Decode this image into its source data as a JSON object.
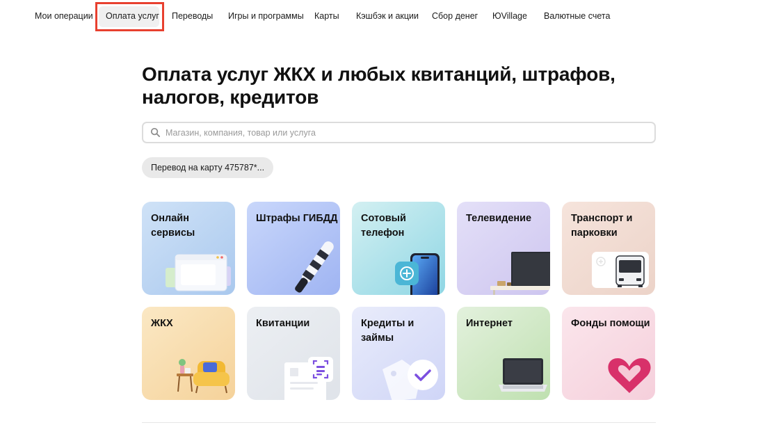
{
  "nav": {
    "items": [
      {
        "label": "Мои операции"
      },
      {
        "label": "Оплата услуг"
      },
      {
        "label": "Переводы"
      },
      {
        "label": "Игры и программы"
      },
      {
        "label": "Карты"
      },
      {
        "label": "Кэшбэк и акции"
      },
      {
        "label": "Сбор денег"
      },
      {
        "label": "ЮVillage"
      },
      {
        "label": "Валютные счета"
      }
    ],
    "active_label": "Оплата услуг",
    "highlight_color": "#e8402f"
  },
  "page": {
    "title": "Оплата услуг ЖКХ и любых квитанций, штрафов, налогов, кредитов"
  },
  "search": {
    "placeholder": "Магазин, компания, товар или услуга",
    "value": ""
  },
  "chips": [
    {
      "label": "Перевод на карту 475787*..."
    }
  ],
  "tiles": [
    {
      "label": "Онлайн сервисы",
      "icon": "browser-window-icon",
      "color": "#a9c8ee"
    },
    {
      "label": "Штрафы ГИБДД",
      "icon": "traffic-baton-icon",
      "color": "#9fb4f2"
    },
    {
      "label": "Сотовый телефон",
      "icon": "smartphone-plus-icon",
      "color": "#8fd6e4"
    },
    {
      "label": "Телевидение",
      "icon": "tv-icon",
      "color": "#cdc5ef"
    },
    {
      "label": "Транспорт и парковки",
      "icon": "bus-icon",
      "color": "#ecd3c8"
    },
    {
      "label": "ЖКХ",
      "icon": "armchair-icon",
      "color": "#f5d29a"
    },
    {
      "label": "Квитанции",
      "icon": "receipt-scan-icon",
      "color": "#dfe3e9"
    },
    {
      "label": "Кредиты и займы",
      "icon": "tag-check-icon",
      "color": "#cfd5f7"
    },
    {
      "label": "Интернет",
      "icon": "laptop-icon",
      "color": "#bfe0b0"
    },
    {
      "label": "Фонды помощи",
      "icon": "heart-icon",
      "color": "#f5cfdb"
    }
  ]
}
